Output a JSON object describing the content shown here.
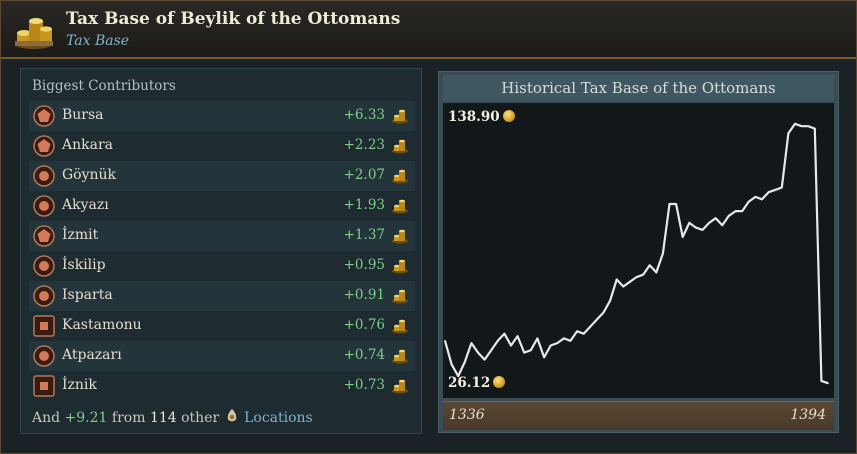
{
  "window": {
    "title": "Tax Base of Beylik of the Ottomans",
    "subtitle": "Tax Base",
    "icon": "coin-stack-icon"
  },
  "contributors": {
    "header": "Biggest Contributors",
    "rows": [
      {
        "name": "Bursa",
        "value": "+6.33",
        "icon": "pentagon-location-icon"
      },
      {
        "name": "Ankara",
        "value": "+2.23",
        "icon": "pentagon-location-icon"
      },
      {
        "name": "Göynük",
        "value": "+2.07",
        "icon": "circle-location-icon"
      },
      {
        "name": "Akyazı",
        "value": "+1.93",
        "icon": "circle-location-icon"
      },
      {
        "name": "İzmit",
        "value": "+1.37",
        "icon": "pentagon-location-icon"
      },
      {
        "name": "İskilip",
        "value": "+0.95",
        "icon": "circle-location-icon"
      },
      {
        "name": "Isparta",
        "value": "+0.91",
        "icon": "circle-location-icon"
      },
      {
        "name": "Kastamonu",
        "value": "+0.76",
        "icon": "square-location-icon"
      },
      {
        "name": "Atpazarı",
        "value": "+0.74",
        "icon": "circle-location-icon"
      },
      {
        "name": "İznik",
        "value": "+0.73",
        "icon": "square-location-icon"
      }
    ],
    "footer": {
      "prefix": "And",
      "amount": "+9.21",
      "mid": "from",
      "count": "114",
      "other": "other",
      "link": "Locations"
    }
  },
  "colors": {
    "positive": "#7ecf8a",
    "link": "#7fb3cf",
    "line": "#e8e8e8",
    "accent_border": "#7a5a2e"
  },
  "chart_data": {
    "type": "line",
    "title": "Historical Tax Base of the Ottomans",
    "xlabel": "",
    "ylabel": "",
    "x_range": [
      1336,
      1394
    ],
    "x_tick_labels": [
      "1336",
      "1394"
    ],
    "y_tick_labels": [
      "138.90",
      "26.12"
    ],
    "ylim": [
      26.12,
      138.9
    ],
    "series": [
      {
        "values": [
          45,
          35,
          30,
          36,
          44,
          40,
          37,
          41,
          45,
          48,
          43,
          47,
          40,
          41,
          46,
          38,
          43,
          44,
          46,
          45,
          49,
          48,
          51,
          54,
          57,
          62,
          71,
          68,
          70,
          72,
          73,
          77,
          74,
          82,
          103,
          103,
          89,
          95,
          93,
          92,
          95,
          97,
          94,
          98,
          100,
          100,
          104,
          106,
          105,
          108,
          109,
          110,
          133,
          137,
          136,
          136,
          135,
          28,
          27
        ]
      }
    ]
  }
}
